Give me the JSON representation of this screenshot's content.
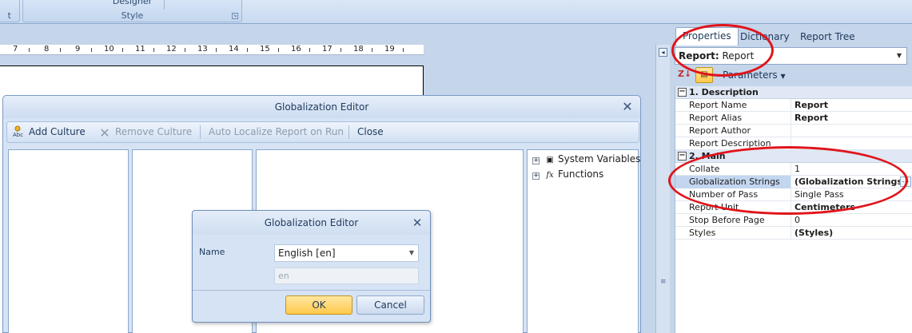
{
  "ribbon": {
    "group_left_char": "t",
    "designer_label": "Designer",
    "style_label": "Style"
  },
  "ruler": [
    "7",
    "8",
    "9",
    "10",
    "11",
    "12",
    "13",
    "14",
    "15",
    "16",
    "17",
    "18",
    "19"
  ],
  "globalization_editor": {
    "title": "Globalization Editor",
    "toolbar": {
      "add_culture": "Add Culture",
      "remove_culture": "Remove Culture",
      "auto_localize": "Auto Localize Report on Run",
      "close": "Close"
    },
    "tree": {
      "system_variables": "System Variables",
      "functions": "Functions"
    }
  },
  "culture_dialog": {
    "title": "Globalization Editor",
    "name_label": "Name",
    "culture_value": "English [en]",
    "code_value": "en",
    "ok_label": "OK",
    "cancel_label": "Cancel"
  },
  "properties_panel": {
    "tabs": [
      "Properties",
      "Dictionary",
      "Report Tree"
    ],
    "selector_bold": "Report:",
    "selector_value": "Report",
    "parameters_label": "Parameters",
    "categories": [
      {
        "title": "1. Description",
        "rows": [
          {
            "key": "Report Name",
            "value": "Report"
          },
          {
            "key": "Report Alias",
            "value": "Report"
          },
          {
            "key": "Report Author",
            "value": ""
          },
          {
            "key": "Report Description",
            "value": ""
          }
        ]
      },
      {
        "title": "2. Main",
        "rows": [
          {
            "key": "Collate",
            "value": "1"
          },
          {
            "key": "Globalization Strings",
            "value": "(Globalization Strings)"
          },
          {
            "key": "Number of Pass",
            "value": "Single Pass"
          },
          {
            "key": "Report Unit",
            "value": "Centimeters"
          },
          {
            "key": "Stop Before Page",
            "value": "0"
          },
          {
            "key": "Styles",
            "value": "(Styles)"
          }
        ]
      }
    ]
  },
  "colors": {
    "annotation": "#e0141b",
    "ok_button": "#ffc94b",
    "frame": "#c5d5ea"
  }
}
